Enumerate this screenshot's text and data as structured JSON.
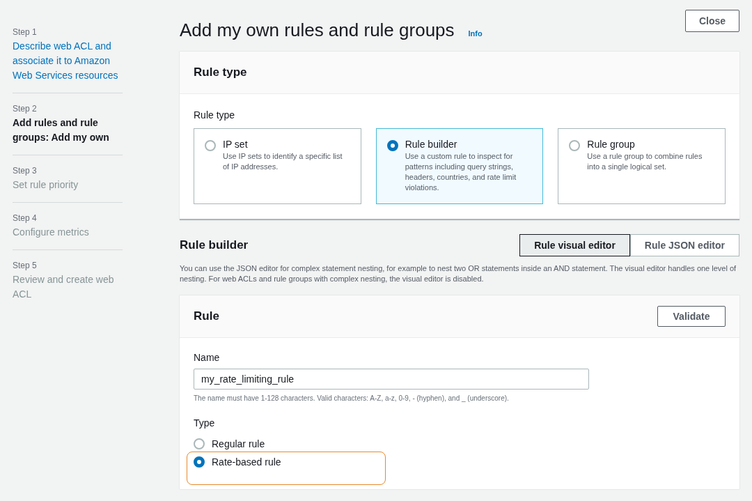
{
  "steps": [
    {
      "label": "Step 1",
      "title": "Describe web ACL and associate it to Amazon Web Services resources",
      "kind": "link"
    },
    {
      "label": "Step 2",
      "title": "Add rules and rule groups: Add my own",
      "kind": "current"
    },
    {
      "label": "Step 3",
      "title": "Set rule priority",
      "kind": "disabled"
    },
    {
      "label": "Step 4",
      "title": "Configure metrics",
      "kind": "disabled"
    },
    {
      "label": "Step 5",
      "title": "Review and create web ACL",
      "kind": "disabled"
    }
  ],
  "page_title": "Add my own rules and rule groups",
  "info_link": "Info",
  "close_button": "Close",
  "rule_type_panel": {
    "heading": "Rule type",
    "label": "Rule type",
    "options": [
      {
        "title": "IP set",
        "description": "Use IP sets to identify a specific list of IP addresses.",
        "selected": false
      },
      {
        "title": "Rule builder",
        "description": "Use a custom rule to inspect for patterns including query strings, headers, countries, and rate limit violations.",
        "selected": true
      },
      {
        "title": "Rule group",
        "description": "Use a rule group to combine rules into a single logical set.",
        "selected": false
      }
    ]
  },
  "rule_builder": {
    "heading": "Rule builder",
    "editor_tabs": [
      {
        "label": "Rule visual editor",
        "selected": true
      },
      {
        "label": "Rule JSON editor",
        "selected": false
      }
    ],
    "description": "You can use the JSON editor for complex statement nesting, for example to nest two OR statements inside an AND statement. The visual editor handles one level of nesting. For web ACLs and rule groups with complex nesting, the visual editor is disabled."
  },
  "rule_panel": {
    "heading": "Rule",
    "validate_button": "Validate",
    "name_label": "Name",
    "name_value": "my_rate_limiting_rule",
    "name_hint": "The name must have 1-128 characters. Valid characters: A-Z, a-z, 0-9, - (hyphen), and _ (underscore).",
    "type_label": "Type",
    "type_options": [
      {
        "label": "Regular rule",
        "selected": false,
        "highlighted": false
      },
      {
        "label": "Rate-based rule",
        "selected": true,
        "highlighted": true
      }
    ]
  }
}
